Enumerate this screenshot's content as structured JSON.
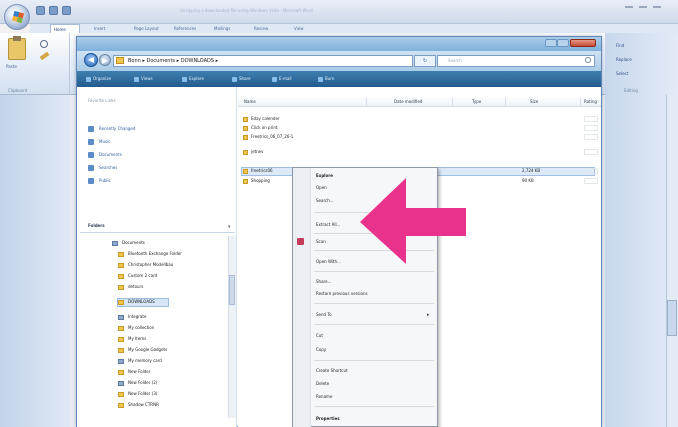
{
  "app": {
    "window_title": "Unzipping a downloaded file using Windows Vista - Microsoft Word",
    "ribbon_tabs": [
      "Home",
      "Insert",
      "Page Layout",
      "References",
      "Mailings",
      "Review",
      "View"
    ],
    "paste_label": "Paste",
    "clipboard_label": "Clipboard",
    "find_label": "Find",
    "replace_label": "Replace",
    "select_label": "Select",
    "editing_label": "Editing"
  },
  "explorer": {
    "address_path": "Bonn ▸ Documents ▸ DOWNLOADS ▸",
    "search_placeholder": "Search",
    "toolbar": {
      "organize": "Organize",
      "views": "Views",
      "explore": "Explore",
      "share": "Share",
      "email": "E-mail",
      "burn": "Burn"
    },
    "favorite_links_header": "Favorite Links",
    "favorite_links": [
      "Recently Changed",
      "Music",
      "Documents",
      "Searches",
      "Public"
    ],
    "folders_header": "Folders",
    "folders": [
      "Documents",
      "Bluetooth Exchange Folder",
      "Christopher Modellbau",
      "Custom 2 card",
      "detours",
      "DOWNLOADS",
      "Integrate",
      "My collection",
      "My Items",
      "My Google Gadgets",
      "My memory card",
      "New Folder",
      "New Folder (2)",
      "New Folder (3)",
      "Shadow CTRNR"
    ],
    "columns": [
      "Name",
      "Date modified",
      "Type",
      "Size",
      "Rating"
    ],
    "files": [
      {
        "name": "Eday calender",
        "size": ""
      },
      {
        "name": "Click on print",
        "size": ""
      },
      {
        "name": "Freetrics_06_07_26-1",
        "size": ""
      },
      {
        "name": "jetnev",
        "size": ""
      },
      {
        "name": "freetrics06",
        "size": "2,724 KB"
      },
      {
        "name": "Shopping",
        "size": "90 KB"
      }
    ]
  },
  "context_menu": {
    "items": [
      "Explore",
      "Open",
      "Search...",
      "Extract All...",
      "Scan",
      "Open With...",
      "Share...",
      "Restore previous versions",
      "Send To",
      "Cut",
      "Copy",
      "Create Shortcut",
      "Delete",
      "Rename",
      "Properties"
    ]
  },
  "colors": {
    "annotation_arrow": "#e8328c",
    "explorer_toolbar": "#235b8f",
    "selection": "#dbe9f8"
  },
  "icons": [
    "office-orb-icon",
    "back-arrow-icon",
    "forward-arrow-icon",
    "search-icon",
    "folder-icon",
    "pink-arrow-annotation"
  ]
}
